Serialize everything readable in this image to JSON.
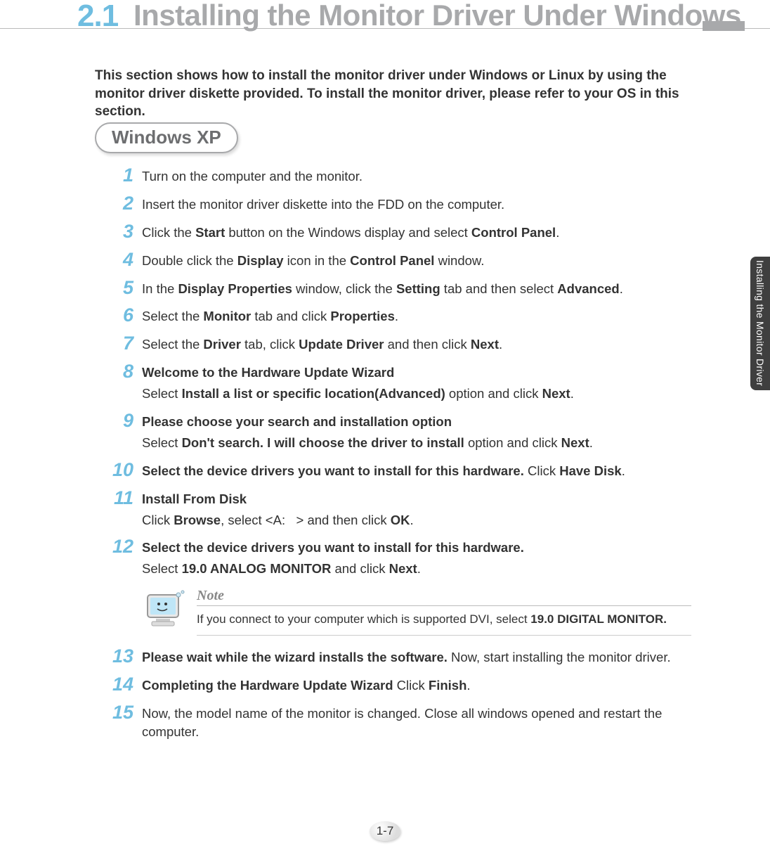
{
  "section_number": "2.1",
  "section_title": "Installing the Monitor Driver Under Windows",
  "intro": "This section shows how to install the monitor driver under Windows or Linux by using the monitor driver diskette provided. To install the monitor driver, please refer to your OS in this section.",
  "os_label": "Windows XP",
  "side_tab": "Installing the Monitor Driver",
  "page_number": "1-7",
  "note": {
    "label": "Note",
    "text_pre": "If you connect to your computer which is supported DVI, select ",
    "text_bold": "19.0 DIGITAL MONITOR."
  },
  "steps": [
    {
      "num": "1",
      "html": "Turn on the computer and the monitor."
    },
    {
      "num": "2",
      "html": "Insert the monitor driver diskette into the FDD on the computer."
    },
    {
      "num": "3",
      "html": "Click the <b>Start</b> button on the Windows display and select <b>Control Panel</b>."
    },
    {
      "num": "4",
      "html": "Double click the <b>Display</b> icon in the <b>Control Panel</b> window."
    },
    {
      "num": "5",
      "html": "In the <b>Display Properties</b> window, click the <b>Setting</b> tab and then select <b>Advanced</b>."
    },
    {
      "num": "6",
      "html": "Select the <b>Monitor</b> tab and click <b>Properties</b>."
    },
    {
      "num": "7",
      "html": "Select the <b>Driver</b> tab, click <b>Update Driver</b> and then click <b>Next</b>."
    },
    {
      "num": "8",
      "html": "<span class='h'>Welcome to the Hardware Update Wizard</span><span class='sub'>Select <b>Install a list or specific location(Advanced)</b> option and click <b>Next</b>.</span>"
    },
    {
      "num": "9",
      "html": "<span class='h'>Please choose your search and installation option</span><span class='sub'>Select <b>Don't search. I will choose the driver to install</b> option and click <b>Next</b>.</span>"
    },
    {
      "num": "10",
      "html": "<b>Select the device drivers you want to install for this hardware.</b> Click <b>Have Disk</b>."
    },
    {
      "num": "11",
      "html": "<span class='h'>Install From Disk</span><span class='sub'>Click <b>Browse</b>, select &lt;A:&nbsp;&nbsp;&nbsp;&gt; and then click <b>OK</b>.</span>"
    },
    {
      "num": "12",
      "html": "<span class='h'>Select the device drivers you want to install for this hardware.</span><span class='sub'>Select <b>19.0 ANALOG MONITOR</b> and click <b>Next</b>.</span>",
      "note_after": true
    },
    {
      "num": "13",
      "html": "<b>Please wait while the wizard installs the software.</b> Now, start installing the monitor driver."
    },
    {
      "num": "14",
      "html": "<b>Completing the Hardware Update Wizard</b> Click <b>Finish</b>."
    },
    {
      "num": "15",
      "html": "Now, the model name of the monitor is changed. Close all windows opened and restart the computer."
    }
  ]
}
